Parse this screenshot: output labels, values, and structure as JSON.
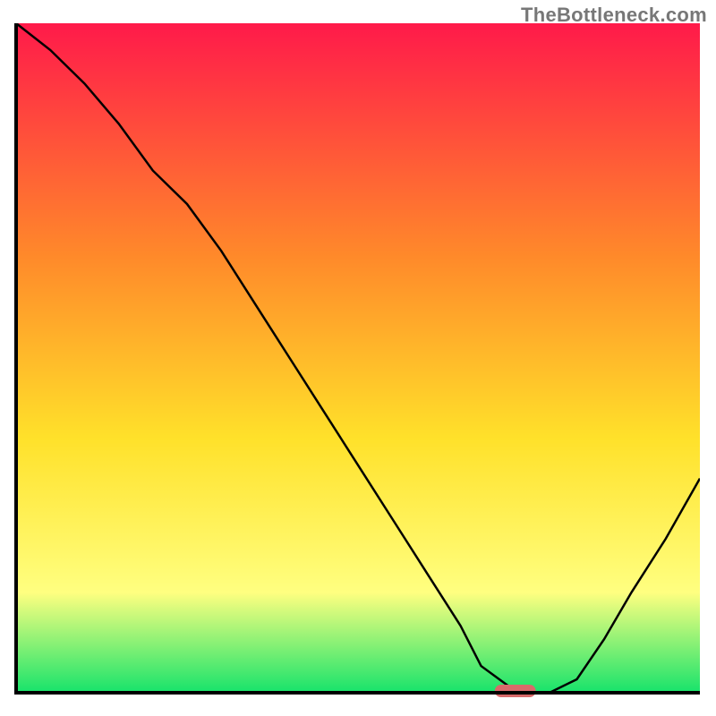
{
  "watermark": "TheBottleneck.com",
  "chart_data": {
    "type": "line",
    "title": "",
    "xlabel": "",
    "ylabel": "",
    "xlim": [
      0,
      100
    ],
    "ylim": [
      0,
      100
    ],
    "x": [
      0,
      5,
      10,
      15,
      20,
      25,
      30,
      35,
      40,
      45,
      50,
      55,
      60,
      65,
      68,
      72,
      76,
      78,
      82,
      86,
      90,
      95,
      100
    ],
    "values": [
      100,
      96,
      91,
      85,
      78,
      73,
      66,
      58,
      50,
      42,
      34,
      26,
      18,
      10,
      4,
      1,
      0,
      0,
      2,
      8,
      15,
      23,
      32
    ],
    "marker": {
      "x": 73,
      "y": 0,
      "width": 6,
      "height": 2,
      "color": "#d86a6a"
    },
    "background_gradient": {
      "top": "#ff1a4a",
      "mid1": "#ff8a2a",
      "mid2": "#ffe12a",
      "mid3": "#ffff80",
      "bottom": "#17e36b"
    },
    "axis_color": "#000000",
    "line_color": "#000000",
    "line_width": 2
  }
}
